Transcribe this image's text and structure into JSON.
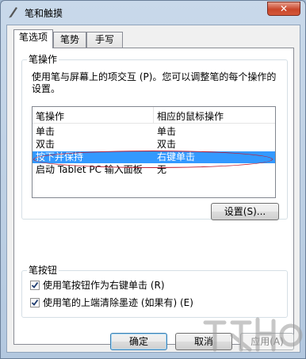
{
  "window": {
    "title": "笔和触摸",
    "close_glyph": "✕"
  },
  "tabs": [
    {
      "label": "笔选项",
      "active": true
    },
    {
      "label": "笔势",
      "active": false
    },
    {
      "label": "手写",
      "active": false
    }
  ],
  "pen_actions": {
    "group_title": "笔操作",
    "description": "使用笔与屏幕上的项交互 (P)。您可以调整笔的每个操作的设置。",
    "columns": [
      "笔操作",
      "相应的鼠标操作"
    ],
    "rows": [
      {
        "action": "单击",
        "mouse": "单击",
        "selected": false
      },
      {
        "action": "双击",
        "mouse": "双击",
        "selected": false
      },
      {
        "action": "按下并保持",
        "mouse": "右键单击",
        "selected": true
      },
      {
        "action": "启动 Tablet PC 输入面板",
        "mouse": "无",
        "selected": false
      }
    ],
    "settings_button": "设置(S)..."
  },
  "pen_buttons": {
    "group_title": "笔按钮",
    "options": [
      {
        "label": "使用笔按钮作为右键单击 (R)",
        "checked": true
      },
      {
        "label": "使用笔的上端清除墨迹 (如果有) (E)",
        "checked": true
      }
    ]
  },
  "footer": {
    "ok": "确定",
    "cancel": "取消",
    "apply": "应用(A)"
  },
  "colors": {
    "selection": "#3399ff",
    "annotation": "#c0182a"
  },
  "icons": {
    "title": "pen-icon",
    "check": "check-icon"
  }
}
